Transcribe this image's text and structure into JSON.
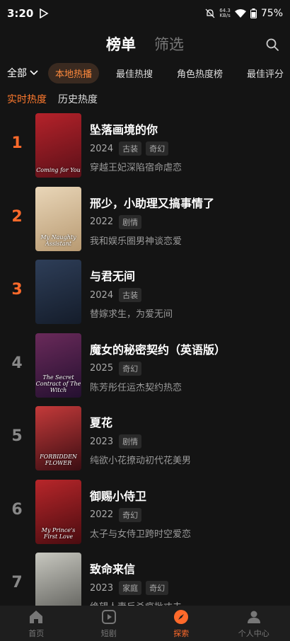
{
  "status": {
    "time": "3:20",
    "net_speed": "64.3",
    "net_unit": "KB/s",
    "battery": "75%"
  },
  "header": {
    "tab_main": "榜单",
    "tab_sub": "筛选"
  },
  "filters": {
    "all_label": "全部",
    "chips": [
      "本地热播",
      "最佳热搜",
      "角色热度榜",
      "最佳评分"
    ]
  },
  "sub_tabs": [
    "实时热度",
    "历史热度"
  ],
  "items": [
    {
      "rank": "1",
      "title": "坠落画境的你",
      "year": "2024",
      "tags": [
        "古装",
        "奇幻"
      ],
      "desc": "穿越王妃深陷宿命虐恋",
      "cover_text": "Coming for You",
      "cover_colors": [
        "#b5222a",
        "#5a1018"
      ]
    },
    {
      "rank": "2",
      "title": "邢少，小助理又搞事情了",
      "year": "2022",
      "tags": [
        "剧情"
      ],
      "desc": "我和娱乐圈男神谈恋爱",
      "cover_text": "My Naughty Assistant",
      "cover_colors": [
        "#e9d6b8",
        "#b89a72"
      ]
    },
    {
      "rank": "3",
      "title": "与君无间",
      "year": "2024",
      "tags": [
        "古装"
      ],
      "desc": "替嫁求生，为爱无间",
      "cover_text": "",
      "cover_colors": [
        "#2e3e58",
        "#141c2a"
      ]
    },
    {
      "rank": "4",
      "title": "魔女的秘密契约（英语版）",
      "year": "2025",
      "tags": [
        "奇幻"
      ],
      "desc": "陈芳彤任运杰契约热恋",
      "cover_text": "The Secret Contract of The Witch",
      "cover_colors": [
        "#6a2a5a",
        "#241030"
      ]
    },
    {
      "rank": "5",
      "title": "夏花",
      "year": "2023",
      "tags": [
        "剧情"
      ],
      "desc": "纯欲小花撩动初代花美男",
      "cover_text": "FORBIDDEN FLOWER",
      "cover_colors": [
        "#c43a3a",
        "#3a0d12"
      ]
    },
    {
      "rank": "6",
      "title": "御赐小侍卫",
      "year": "2022",
      "tags": [
        "奇幻"
      ],
      "desc": "太子与女侍卫跨时空爱恋",
      "cover_text": "My Prince's First Love",
      "cover_colors": [
        "#b8262a",
        "#4a0c10"
      ]
    },
    {
      "rank": "7",
      "title": "致命来信",
      "year": "2023",
      "tags": [
        "家庭",
        "奇幻"
      ],
      "desc": "绝望人妻反杀疯批丈夫",
      "cover_text": "",
      "cover_colors": [
        "#c8c8c0",
        "#5a5a56"
      ]
    }
  ],
  "bottom_nav": [
    "首页",
    "短剧",
    "探索",
    "个人中心"
  ],
  "colors": {
    "accent": "#ff6a2b",
    "background": "#141414"
  }
}
